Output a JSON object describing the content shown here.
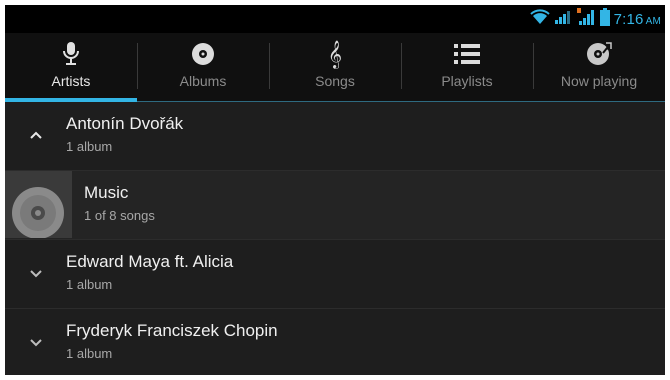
{
  "status": {
    "time": "7:16",
    "ampm": "AM",
    "icons": [
      "wifi-icon",
      "signal-icon",
      "signal-2-icon",
      "battery-icon"
    ]
  },
  "tabs": [
    {
      "label": "Artists",
      "icon": "microphone-icon",
      "active": true
    },
    {
      "label": "Albums",
      "icon": "disc-icon",
      "active": false
    },
    {
      "label": "Songs",
      "icon": "treble-clef-icon",
      "active": false
    },
    {
      "label": "Playlists",
      "icon": "playlist-icon",
      "active": false
    },
    {
      "label": "Now playing",
      "icon": "now-playing-icon",
      "active": false
    }
  ],
  "list": {
    "artists": [
      {
        "name": "Antonín Dvořák",
        "count": "1 album",
        "expanded": true
      },
      {
        "name": "Edward Maya ft. Alicia",
        "count": "1 album",
        "expanded": false
      },
      {
        "name": "Fryderyk Franciszek Chopin",
        "count": "1 album",
        "expanded": false
      }
    ],
    "album": {
      "title": "Music",
      "songs": "1 of 8 songs"
    }
  },
  "colors": {
    "accent": "#33b5e5",
    "background": "#1e1e1e",
    "tabbar": "#101010"
  }
}
